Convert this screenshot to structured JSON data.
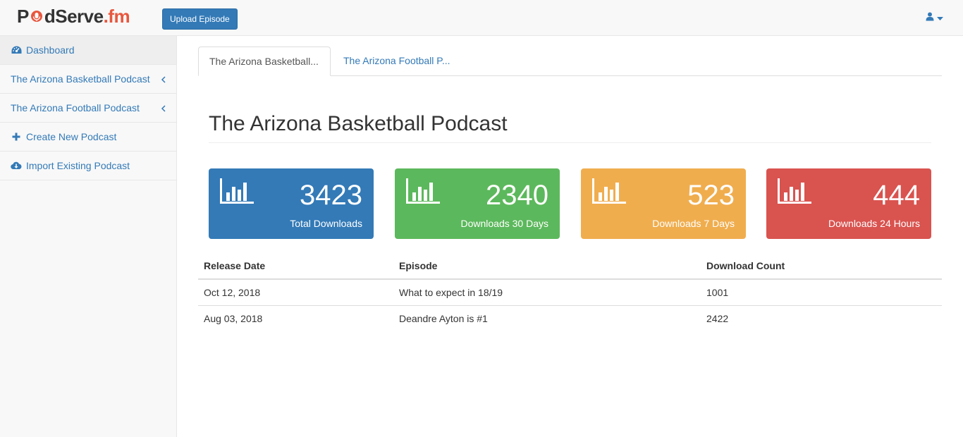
{
  "navbar": {
    "brand_prefix": "P",
    "brand_middle": "dServe",
    "brand_suffix": ".fm",
    "upload_label": "Upload Episode",
    "user_icon": "user-icon",
    "caret_icon": "caret-down-icon"
  },
  "sidebar": {
    "items": [
      {
        "label": "Dashboard",
        "icon": "dashboard-icon"
      },
      {
        "label": "The Arizona Basketball Podcast",
        "icon": "chevron-left-icon"
      },
      {
        "label": "The Arizona Football Podcast",
        "icon": "chevron-left-icon"
      },
      {
        "label": "Create New Podcast",
        "icon": "plus-icon"
      },
      {
        "label": "Import Existing Podcast",
        "icon": "cloud-download-icon"
      }
    ]
  },
  "tabs": [
    {
      "label": "The Arizona Basketball...",
      "active": true
    },
    {
      "label": "The Arizona Football P...",
      "active": false
    }
  ],
  "page_title": "The Arizona Basketball Podcast",
  "stats": [
    {
      "value": "3423",
      "label": "Total Downloads",
      "color": "#337ab7",
      "icon": "bar-chart-icon"
    },
    {
      "value": "2340",
      "label": "Downloads 30 Days",
      "color": "#5cb85c",
      "icon": "bar-chart-icon"
    },
    {
      "value": "523",
      "label": "Downloads 7 Days",
      "color": "#f0ad4e",
      "icon": "bar-chart-icon"
    },
    {
      "value": "444",
      "label": "Downloads 24 Hours",
      "color": "#d9534f",
      "icon": "bar-chart-icon"
    }
  ],
  "table": {
    "headers": [
      "Release Date",
      "Episode",
      "Download Count"
    ],
    "rows": [
      [
        "Oct 12, 2018",
        "What to expect in 18/19",
        "1001"
      ],
      [
        "Aug 03, 2018",
        "Deandre Ayton is #1",
        "2422"
      ]
    ]
  },
  "colors": {
    "link": "#337ab7",
    "brand_accent": "#e8573e"
  }
}
